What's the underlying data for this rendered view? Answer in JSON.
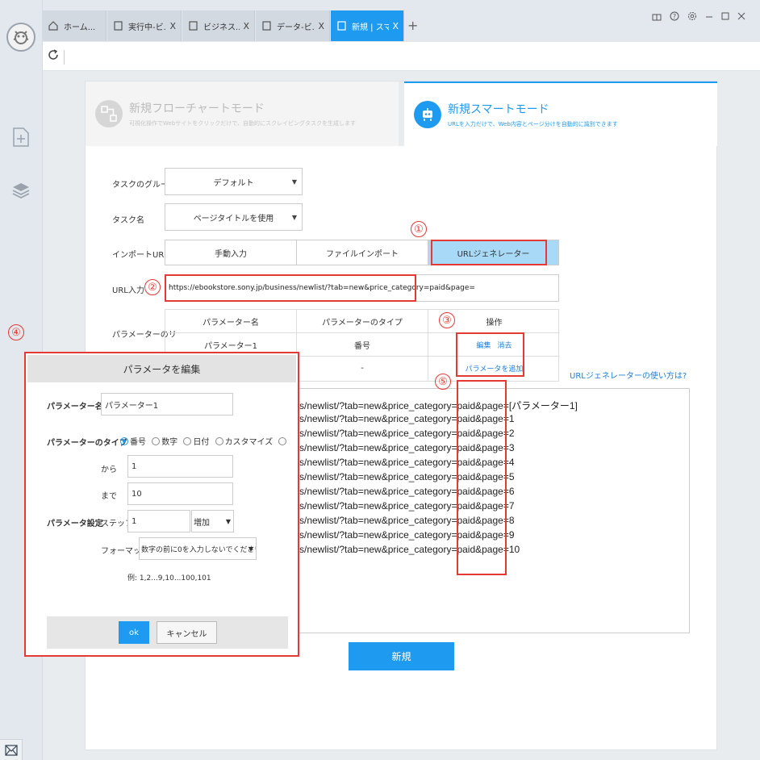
{
  "tabs": [
    {
      "label": "ホーム...",
      "icon": "home-icon",
      "close": ""
    },
    {
      "label": "実行中-ビ...",
      "icon": "page-icon",
      "close": "X"
    },
    {
      "label": "ビジネス...",
      "icon": "page-icon",
      "close": "X"
    },
    {
      "label": "データ-ビ...",
      "icon": "page-icon",
      "close": "X"
    },
    {
      "label": "新規 | スマ...",
      "icon": "page-icon",
      "close": "X"
    }
  ],
  "tab_plus": "+",
  "modes": {
    "flow": {
      "title": "新規フローチャートモード",
      "desc": "可視化操作でWebサイトをクリックだけで、自動的にスクレイピングタスクを生成します"
    },
    "smart": {
      "title": "新規スマートモード",
      "desc": "URLを入力だけで、Web内容とページ分けを自動的に識別できます"
    }
  },
  "form": {
    "group_label": "タスクのグループ",
    "group_value": "デフォルト",
    "name_label": "タスク名",
    "name_value": "ページタイトルを使用",
    "import_label": "インポートURL",
    "import_options": [
      "手動入力",
      "ファイルインポート",
      "URLジェネレーター"
    ],
    "url_label": "URL入力",
    "url_value": "https://ebookstore.sony.jp/business/newlist/?tab=new&price_category=paid&page=",
    "param_label": "パラメーターのリ"
  },
  "param_table": {
    "headers": [
      "パラメーター名",
      "パラメーターのタイプ",
      "操作"
    ],
    "row": {
      "name": "パラメーター1",
      "type": "番号",
      "edit": "編集",
      "delete": "消去"
    },
    "row2": {
      "type": "-",
      "add": "パラメータを追加"
    }
  },
  "howto_link": "URLジェネレーターの使い方は?",
  "generated_urls": [
    "s/newlist/?tab=new&price_category=paid&page=[パラメーター1]",
    "s/newlist/?tab=new&price_category=paid&page=1",
    "s/newlist/?tab=new&price_category=paid&page=2",
    "s/newlist/?tab=new&price_category=paid&page=3",
    "s/newlist/?tab=new&price_category=paid&page=4",
    "s/newlist/?tab=new&price_category=paid&page=5",
    "s/newlist/?tab=new&price_category=paid&page=6",
    "s/newlist/?tab=new&price_category=paid&page=7",
    "s/newlist/?tab=new&price_category=paid&page=8",
    "s/newlist/?tab=new&price_category=paid&page=9",
    "s/newlist/?tab=new&price_category=paid&page=10"
  ],
  "new_button": "新規",
  "markers": [
    "①",
    "②",
    "③",
    "④",
    "⑤"
  ],
  "dialog": {
    "title": "パラメータを編集",
    "name_label": "パラメーター名",
    "name_value": "パラメーター1",
    "type_label": "パラメーターのタイプ",
    "type_options": [
      "番号",
      "数字",
      "日付",
      "カスタマイズ",
      ""
    ],
    "from_label": "から",
    "from_value": "1",
    "to_label": "まで",
    "to_value": "10",
    "setting_label": "パラメータ設定",
    "step_label": "ステップ",
    "step_value": "1",
    "step_dir": "増加",
    "format_label": "フォーマット",
    "format_value": "数字の前に0を入力しないでください",
    "example": "例: 1,2...9,10...100,101",
    "ok": "ok",
    "cancel": "キャンセル"
  },
  "colors": {
    "accent": "#1e9bf0",
    "annotation": "#e53935",
    "segment_active": "#a8daf7"
  }
}
